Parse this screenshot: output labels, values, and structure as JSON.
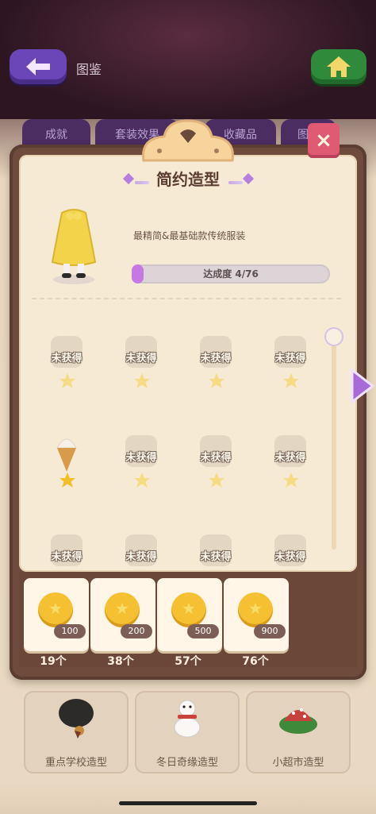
{
  "header": {
    "title": "图鉴",
    "back_icon": "back-arrow-icon",
    "home_icon": "home-icon"
  },
  "tabs": [
    {
      "label": "成就"
    },
    {
      "label": "套装效果"
    },
    {
      "label": "收藏品"
    },
    {
      "label": "图鉴"
    }
  ],
  "set_card": {
    "title": "简约造型",
    "description": "最精简&最基础款传统服装",
    "progress_label": "达成度 4/76",
    "progress_fraction": 0.0526,
    "close_icon": "×"
  },
  "collection_items": [
    {
      "status": "未获得",
      "icon": "umbrella-icon"
    },
    {
      "status": "未获得",
      "icon": "sign-board-icon"
    },
    {
      "status": "未获得",
      "icon": "spoon-icon"
    },
    {
      "status": "未获得",
      "icon": "mirror-icon"
    },
    {
      "status": "",
      "icon": "ice-cream-cone-icon"
    },
    {
      "status": "未获得",
      "icon": "ice-cream-scoop-icon"
    },
    {
      "status": "未获得",
      "icon": "popsicle-icon"
    },
    {
      "status": "未获得",
      "icon": "bread-slice-icon"
    },
    {
      "status": "未获得",
      "icon": "bread-slice-icon"
    },
    {
      "status": "未获得",
      "icon": "bread-slice-icon"
    },
    {
      "status": "未获得",
      "icon": "bread-slice-icon"
    },
    {
      "status": "未获得",
      "icon": "bowling-ball-icon"
    }
  ],
  "rewards": [
    {
      "amount": "100",
      "count": "19个"
    },
    {
      "amount": "200",
      "count": "38个"
    },
    {
      "amount": "500",
      "count": "57个"
    },
    {
      "amount": "900",
      "count": "76个"
    }
  ],
  "bottom_sets": [
    {
      "label": "重点学校造型",
      "icon": "graduation-cap-icon"
    },
    {
      "label": "冬日奇缘造型",
      "icon": "snowman-icon"
    },
    {
      "label": "小超市造型",
      "icon": "cake-icon"
    }
  ],
  "colors": {
    "accent_purple": "#c678e3",
    "panel_brown": "#6e4b3d",
    "paper": "#f6ead5",
    "coin_gold": "#f5c032"
  }
}
